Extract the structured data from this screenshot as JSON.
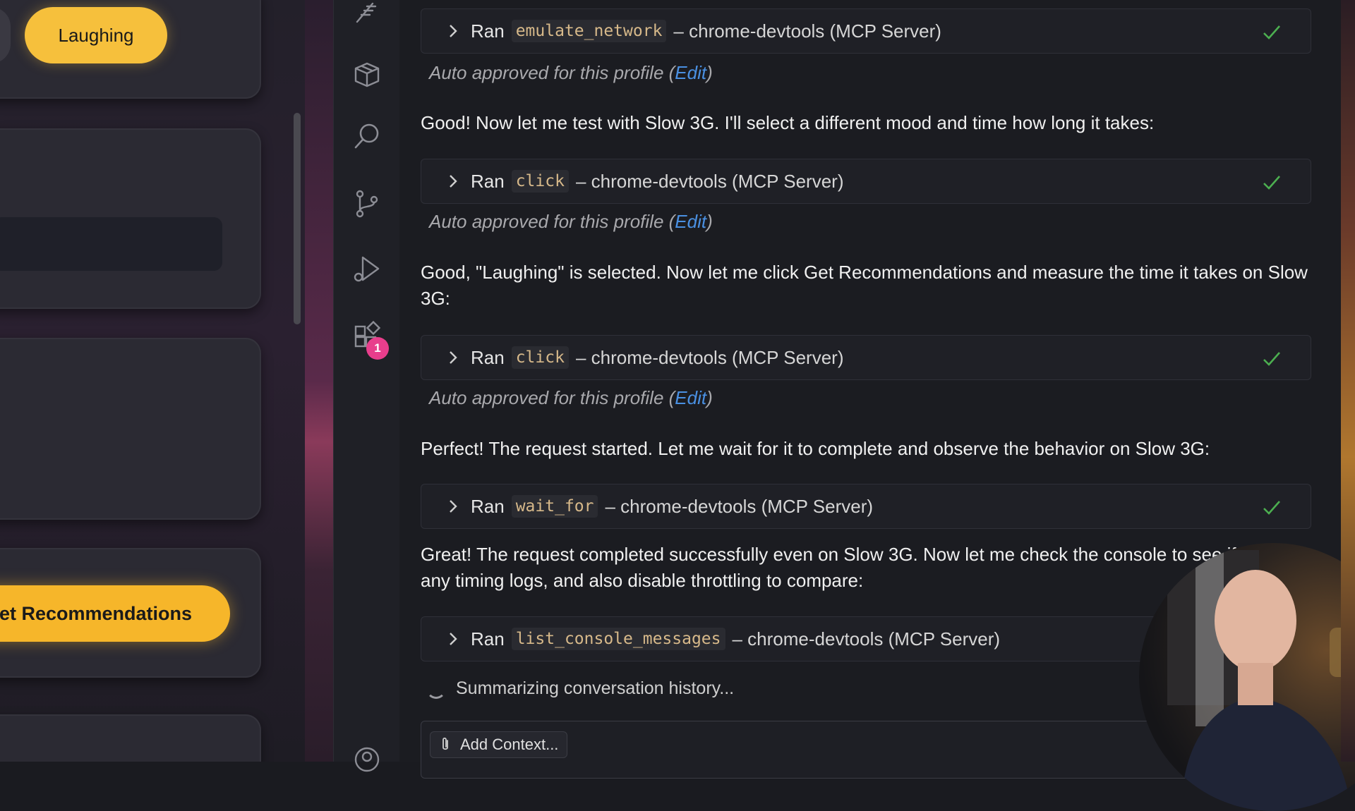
{
  "left_panel": {
    "mood_button_label": "Laughing",
    "recommendations_button_label": "Get Recommendations"
  },
  "activity_bar": {
    "icons": [
      "feather-icon",
      "package-icon",
      "search-icon",
      "source-control-icon",
      "run-debug-icon",
      "extensions-icon",
      "account-icon"
    ],
    "extensions_badge": "1"
  },
  "chat": {
    "tool_calls": [
      {
        "ran": "Ran",
        "tool": "emulate_network",
        "server": "– chrome-devtools (MCP Server)",
        "approved": true
      },
      {
        "ran": "Ran",
        "tool": "click",
        "server": "– chrome-devtools (MCP Server)",
        "approved": true
      },
      {
        "ran": "Ran",
        "tool": "click",
        "server": "– chrome-devtools (MCP Server)",
        "approved": true
      },
      {
        "ran": "Ran",
        "tool": "wait_for",
        "server": "– chrome-devtools (MCP Server)",
        "approved": false
      },
      {
        "ran": "Ran",
        "tool": "list_console_messages",
        "server": "– chrome-devtools (MCP Server)",
        "approved": false
      }
    ],
    "approval_text": "Auto approved for this profile (",
    "approval_edit": "Edit",
    "approval_close": ")",
    "messages": [
      "Good! Now let me test with Slow 3G. I'll select a different mood and time how long it takes:",
      "Good, \"Laughing\" is selected. Now let me click Get Recommendations and measure the time it takes on Slow 3G:",
      "Perfect! The request started. Let me wait for it to complete and observe the behavior on Slow 3G:",
      "Great! The request completed successfully even on Slow 3G. Now let me check the console to see if there are any timing logs, and also disable throttling to compare:"
    ],
    "status_text": "Summarizing conversation history...",
    "add_context_label": "Add Context..."
  },
  "colors": {
    "accent_yellow": "#f6c03c",
    "link_blue": "#4a90e2",
    "badge_pink": "#e83e8c",
    "check_green": "#4caf50",
    "code_text": "#d7b98a"
  }
}
